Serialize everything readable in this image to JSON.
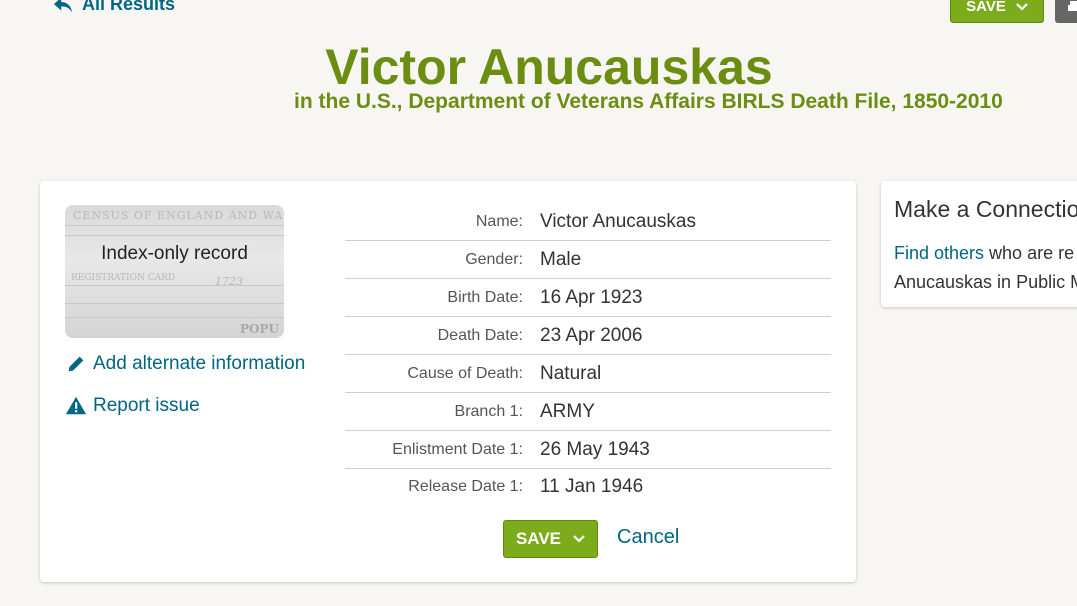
{
  "nav": {
    "back_label": "All Results"
  },
  "top_actions": {
    "save_label": "SAVE"
  },
  "record": {
    "name": "Victor Anucauskas",
    "collection": "in the U.S., Department of Veterans Affairs BIRLS Death File, 1850-2010"
  },
  "thumbnail": {
    "label": "Index-only record",
    "faint_header": "CENSUS OF ENGLAND AND WALES,",
    "faint_text": [
      "REGISTRATION CARD",
      "1723",
      "POPU"
    ]
  },
  "side_actions": {
    "add_alt_label": "Add alternate information",
    "report_label": "Report issue"
  },
  "fields": [
    {
      "label": "Name:",
      "value": "Victor Anucauskas"
    },
    {
      "label": "Gender:",
      "value": "Male"
    },
    {
      "label": "Birth Date:",
      "value": "16 Apr 1923"
    },
    {
      "label": "Death Date:",
      "value": "23 Apr 2006"
    },
    {
      "label": "Cause of Death:",
      "value": "Natural"
    },
    {
      "label": "Branch 1:",
      "value": "ARMY"
    },
    {
      "label": "Enlistment Date 1:",
      "value": "26 May 1943"
    },
    {
      "label": "Release Date 1:",
      "value": "11 Jan 1946"
    }
  ],
  "form_actions": {
    "save_label": "SAVE",
    "cancel_label": "Cancel"
  },
  "connection": {
    "title": "Make a Connectio",
    "link_text": "Find others",
    "text_after_link": " who are re",
    "text_line2": "Anucauskas in Public M"
  },
  "colors": {
    "brand_green": "#6b8e12",
    "button_green": "#7cab1c",
    "link_blue": "#006683"
  }
}
